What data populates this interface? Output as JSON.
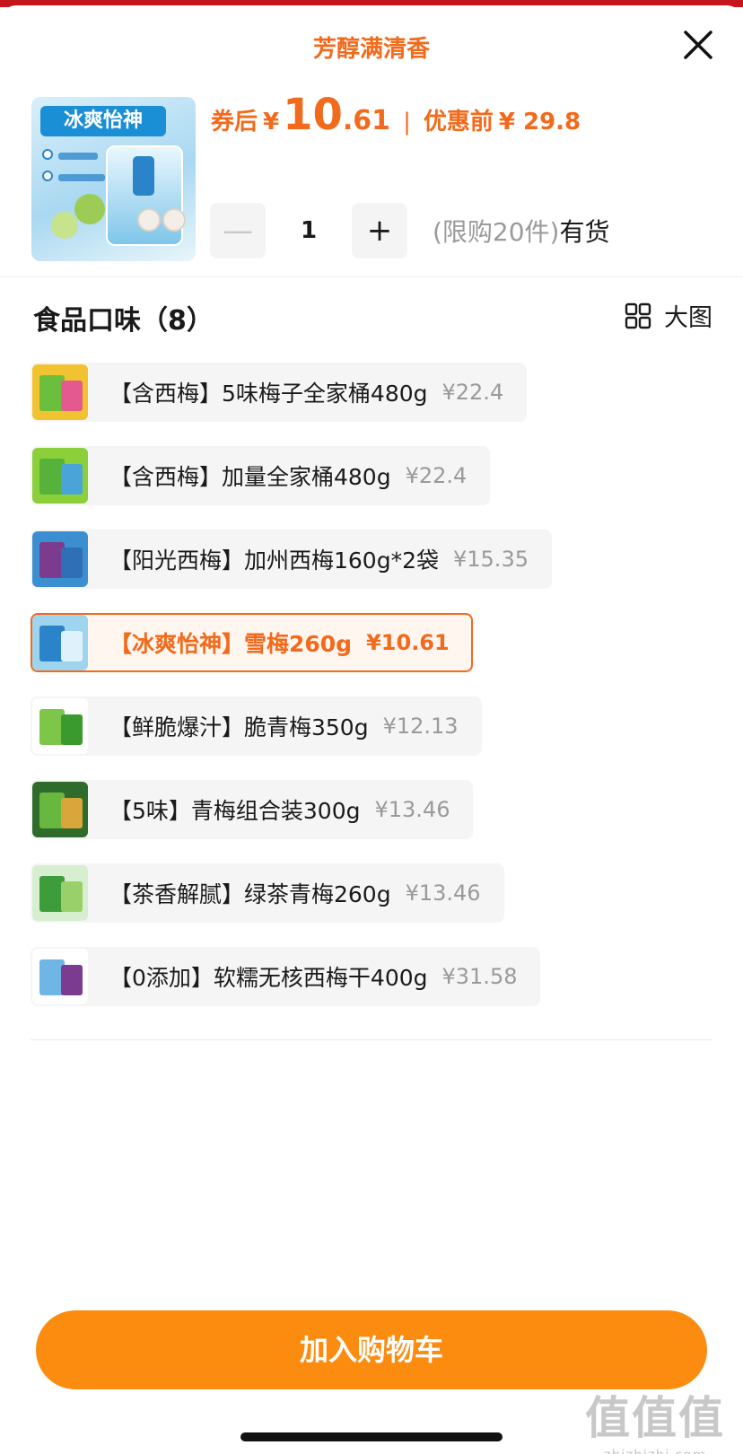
{
  "header": {
    "title": "芳醇满清香",
    "close_icon": "close-icon"
  },
  "product": {
    "thumb_brand_text": "冰爽怡神",
    "price_after_coupon_label": "券后",
    "currency": "¥",
    "price_int": "10",
    "price_dec": ".61",
    "separator": "|",
    "original_price_label": "优惠前",
    "original_price": "¥ 29.8",
    "quantity": "1",
    "minus_label": "—",
    "plus_label": "+",
    "limit_text": "(限购20件)",
    "stock_text": "有货"
  },
  "section": {
    "title": "食品口味（8）",
    "big_view_label": "大图",
    "big_view_icon": "grid-icon"
  },
  "options": [
    {
      "name": "【含西梅】5味梅子全家桶480g",
      "price": "¥22.4",
      "selected": false,
      "thumb_colors": [
        "#f2c331",
        "#6cbf3c",
        "#e45a8f"
      ]
    },
    {
      "name": "【含西梅】加量全家桶480g",
      "price": "¥22.4",
      "selected": false,
      "thumb_colors": [
        "#8bcf3a",
        "#56b23a",
        "#4aa4d8"
      ]
    },
    {
      "name": "【阳光西梅】加州西梅160g*2袋",
      "price": "¥15.35",
      "selected": false,
      "thumb_colors": [
        "#3b8fd1",
        "#7b3b8f",
        "#2e6fb5"
      ]
    },
    {
      "name": "【冰爽怡神】雪梅260g",
      "price": "¥10.61",
      "selected": true,
      "thumb_colors": [
        "#9fd4ef",
        "#2b84c9",
        "#dff2fb"
      ]
    },
    {
      "name": "【鲜脆爆汁】脆青梅350g",
      "price": "¥12.13",
      "selected": false,
      "thumb_colors": [
        "#ffffff",
        "#7ec64a",
        "#3a9a2e"
      ]
    },
    {
      "name": "【5味】青梅组合装300g",
      "price": "¥13.46",
      "selected": false,
      "thumb_colors": [
        "#2f6b2b",
        "#68b83f",
        "#d8a63a"
      ]
    },
    {
      "name": "【茶香解腻】绿茶青梅260g",
      "price": "¥13.46",
      "selected": false,
      "thumb_colors": [
        "#d7efd0",
        "#3c9d3a",
        "#9ad06a"
      ]
    },
    {
      "name": "【0添加】软糯无核西梅干400g",
      "price": "¥31.58",
      "selected": false,
      "thumb_colors": [
        "#ffffff",
        "#6fb6e4",
        "#7b3b8f"
      ]
    }
  ],
  "footer": {
    "add_to_cart_label": "加入购物车"
  },
  "watermark": {
    "big": "值值值",
    "small": "zhizhizhi.com"
  },
  "colors": {
    "accent": "#f26a1b",
    "cart_button": "#fb8c10"
  }
}
